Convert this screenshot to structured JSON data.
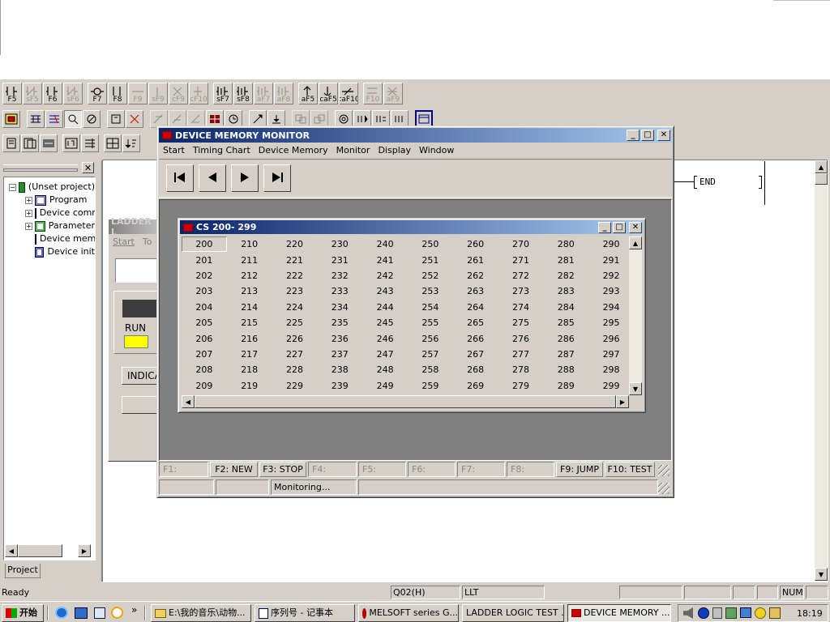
{
  "toolbar1": {
    "buttons": [
      {
        "key": "F5",
        "enabled": true
      },
      {
        "key": "sF5",
        "enabled": false
      },
      {
        "key": "F6",
        "enabled": true
      },
      {
        "key": "sF6",
        "enabled": false
      },
      {
        "key": "F7",
        "enabled": true
      },
      {
        "key": "F8",
        "enabled": true
      },
      {
        "key": "F9",
        "enabled": false
      },
      {
        "key": "sF9",
        "enabled": false
      },
      {
        "key": "cF9",
        "enabled": false
      },
      {
        "key": "cF10",
        "enabled": false
      },
      {
        "key": "sF7",
        "enabled": true
      },
      {
        "key": "sF8",
        "enabled": true
      },
      {
        "key": "aF7",
        "enabled": false
      },
      {
        "key": "aF8",
        "enabled": false
      },
      {
        "key": "aF5",
        "enabled": true
      },
      {
        "key": "caF5",
        "enabled": true
      },
      {
        "key": "caF10",
        "enabled": true
      },
      {
        "key": "F10",
        "enabled": false
      },
      {
        "key": "aF9",
        "enabled": false
      }
    ]
  },
  "project_panel": {
    "tree": [
      {
        "label": "(Unset project)",
        "level": 0,
        "expander": "−"
      },
      {
        "label": "Program",
        "level": 1,
        "expander": "+"
      },
      {
        "label": "Device comment",
        "level": 1,
        "expander": "+"
      },
      {
        "label": "Parameter",
        "level": 1,
        "expander": "+"
      },
      {
        "label": "Device memory",
        "level": 1,
        "expander": ""
      },
      {
        "label": "Device init",
        "level": 1,
        "expander": ""
      }
    ],
    "tab_label": "Project"
  },
  "ladder_window": {
    "title": "LADDER L",
    "menu": [
      "Start",
      "To"
    ],
    "run_label": "RUN",
    "indicator_label": "INDICA",
    "run_color": "#ffff00"
  },
  "ladder_end_label": "END",
  "dmm": {
    "title": "DEVICE MEMORY MONITOR",
    "menu": [
      "Start",
      "Timing Chart",
      "Device Memory",
      "Monitor",
      "Display",
      "Window"
    ],
    "nav": [
      "first-icon",
      "prev-icon",
      "next-icon",
      "last-icon"
    ],
    "fkeys": [
      {
        "label": "F1:",
        "enabled": false
      },
      {
        "label": "F2: NEW",
        "enabled": true
      },
      {
        "label": "F3: STOP",
        "enabled": true
      },
      {
        "label": "F4:",
        "enabled": false
      },
      {
        "label": "F5:",
        "enabled": false
      },
      {
        "label": "F6:",
        "enabled": false
      },
      {
        "label": "F7:",
        "enabled": false
      },
      {
        "label": "F8:",
        "enabled": false
      },
      {
        "label": "F9: JUMP",
        "enabled": true
      },
      {
        "label": "F10: TEST",
        "enabled": true
      }
    ],
    "status_monitoring": "Monitoring..."
  },
  "cs": {
    "title": "CS 200- 299",
    "values": [
      "200",
      "210",
      "220",
      "230",
      "240",
      "250",
      "260",
      "270",
      "280",
      "290",
      "201",
      "211",
      "221",
      "231",
      "241",
      "251",
      "261",
      "271",
      "281",
      "291",
      "202",
      "212",
      "222",
      "232",
      "242",
      "252",
      "262",
      "272",
      "282",
      "292",
      "203",
      "213",
      "223",
      "233",
      "243",
      "253",
      "263",
      "273",
      "283",
      "293",
      "204",
      "214",
      "224",
      "234",
      "244",
      "254",
      "264",
      "274",
      "284",
      "294",
      "205",
      "215",
      "225",
      "235",
      "245",
      "255",
      "265",
      "275",
      "285",
      "295",
      "206",
      "216",
      "226",
      "236",
      "246",
      "256",
      "266",
      "276",
      "286",
      "296",
      "207",
      "217",
      "227",
      "237",
      "247",
      "257",
      "267",
      "277",
      "287",
      "297",
      "208",
      "218",
      "228",
      "238",
      "248",
      "258",
      "268",
      "278",
      "288",
      "298",
      "209",
      "219",
      "229",
      "239",
      "249",
      "259",
      "269",
      "279",
      "289",
      "299"
    ],
    "selected": "200"
  },
  "statusbar": {
    "ready": "Ready",
    "cpu": "Q02(H)",
    "mode": "LLT",
    "num": "NUM"
  },
  "taskbar": {
    "start": "开始",
    "chevron": "»",
    "tasks": [
      {
        "label": "E:\\我的音乐\\动物...",
        "active": false
      },
      {
        "label": "序列号 - 记事本",
        "active": false
      },
      {
        "label": "MELSOFT series G...",
        "active": false
      },
      {
        "label": "LADDER LOGIC TEST ...",
        "active": false
      },
      {
        "label": "DEVICE MEMORY ...",
        "active": true
      }
    ],
    "clock": "18:19"
  }
}
